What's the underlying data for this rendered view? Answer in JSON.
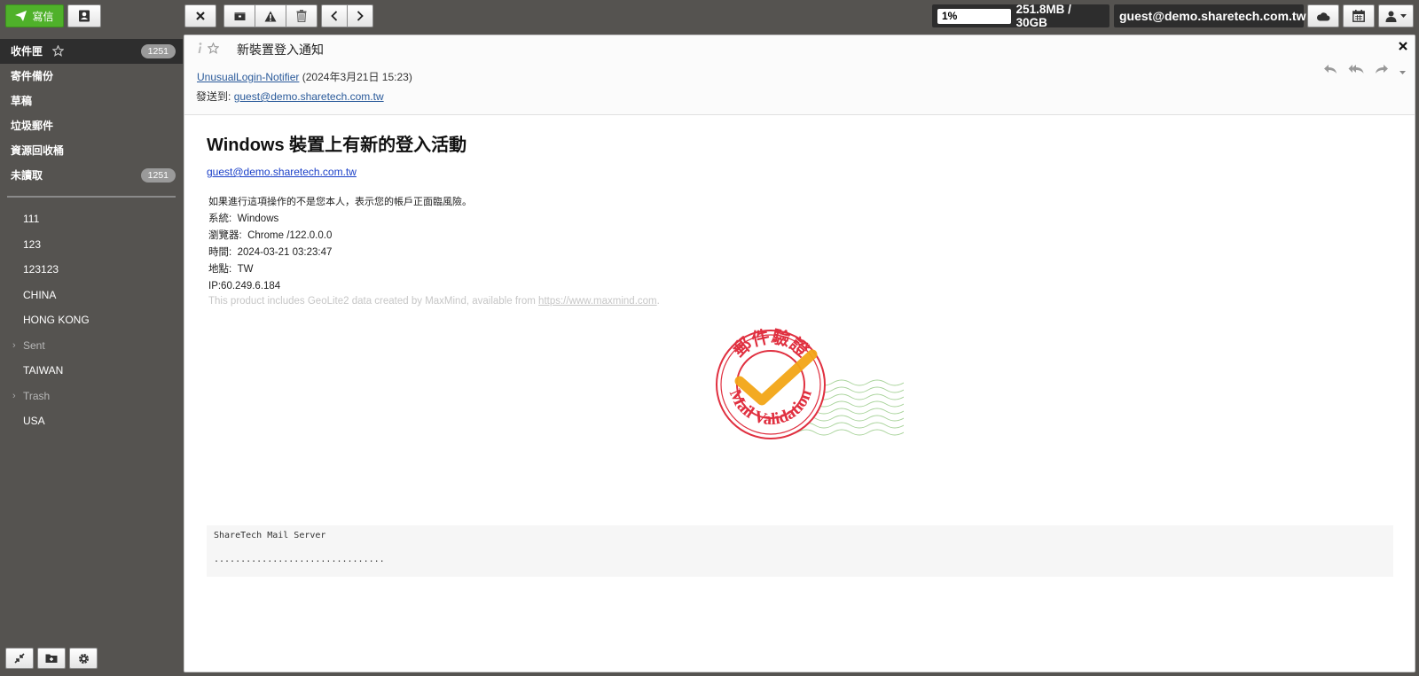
{
  "toolbar": {
    "compose_label": "寫信",
    "quota_percent": "1%",
    "quota_usage": "251.8MB / 30GB",
    "account": "guest@demo.sharetech.com.tw",
    "accent_color": "#4fb12a"
  },
  "sidebar": {
    "main_folders": [
      {
        "label": "收件匣",
        "count": "1251"
      },
      {
        "label": "寄件備份"
      },
      {
        "label": "草稿"
      },
      {
        "label": "垃圾郵件"
      },
      {
        "label": "資源回收桶"
      },
      {
        "label": "未讀取",
        "count": "1251"
      }
    ],
    "custom_folders": [
      {
        "label": "111"
      },
      {
        "label": "123"
      },
      {
        "label": "123123"
      },
      {
        "label": "CHINA"
      },
      {
        "label": "HONG KONG"
      },
      {
        "label": "Sent"
      },
      {
        "label": "TAIWAN"
      },
      {
        "label": "Trash"
      },
      {
        "label": "USA"
      }
    ]
  },
  "message": {
    "subject": "新裝置登入通知",
    "sender": "UnusualLogin-Notifier",
    "date": "(2024年3月21日 15:23)",
    "to_label": "發送到:",
    "to_address": "guest@demo.sharetech.com.tw",
    "title": "Windows 裝置上有新的登入活動",
    "account_link": "guest@demo.sharetech.com.tw",
    "warning": "如果進行這項操作的不是您本人，表示您的帳戶正面臨風險。",
    "system_label": "系統:",
    "system": "Windows",
    "browser_label": "瀏覽器:",
    "browser": "Chrome /122.0.0.0",
    "time_label": "時間:",
    "time": "2024-03-21 03:23:47",
    "location_label": "地點:",
    "location": "TW",
    "ip_line": "IP:60.249.6.184",
    "geo_note": "This product includes GeoLite2 data created by MaxMind, available from",
    "geo_link": "https://www.maxmind.com",
    "geo_end": ".",
    "stamp_top_text": "郵件驗證",
    "stamp_bottom_text": "Mail Validation",
    "footer_name": "ShareTech Mail Server",
    "footer_dots": "................................"
  }
}
